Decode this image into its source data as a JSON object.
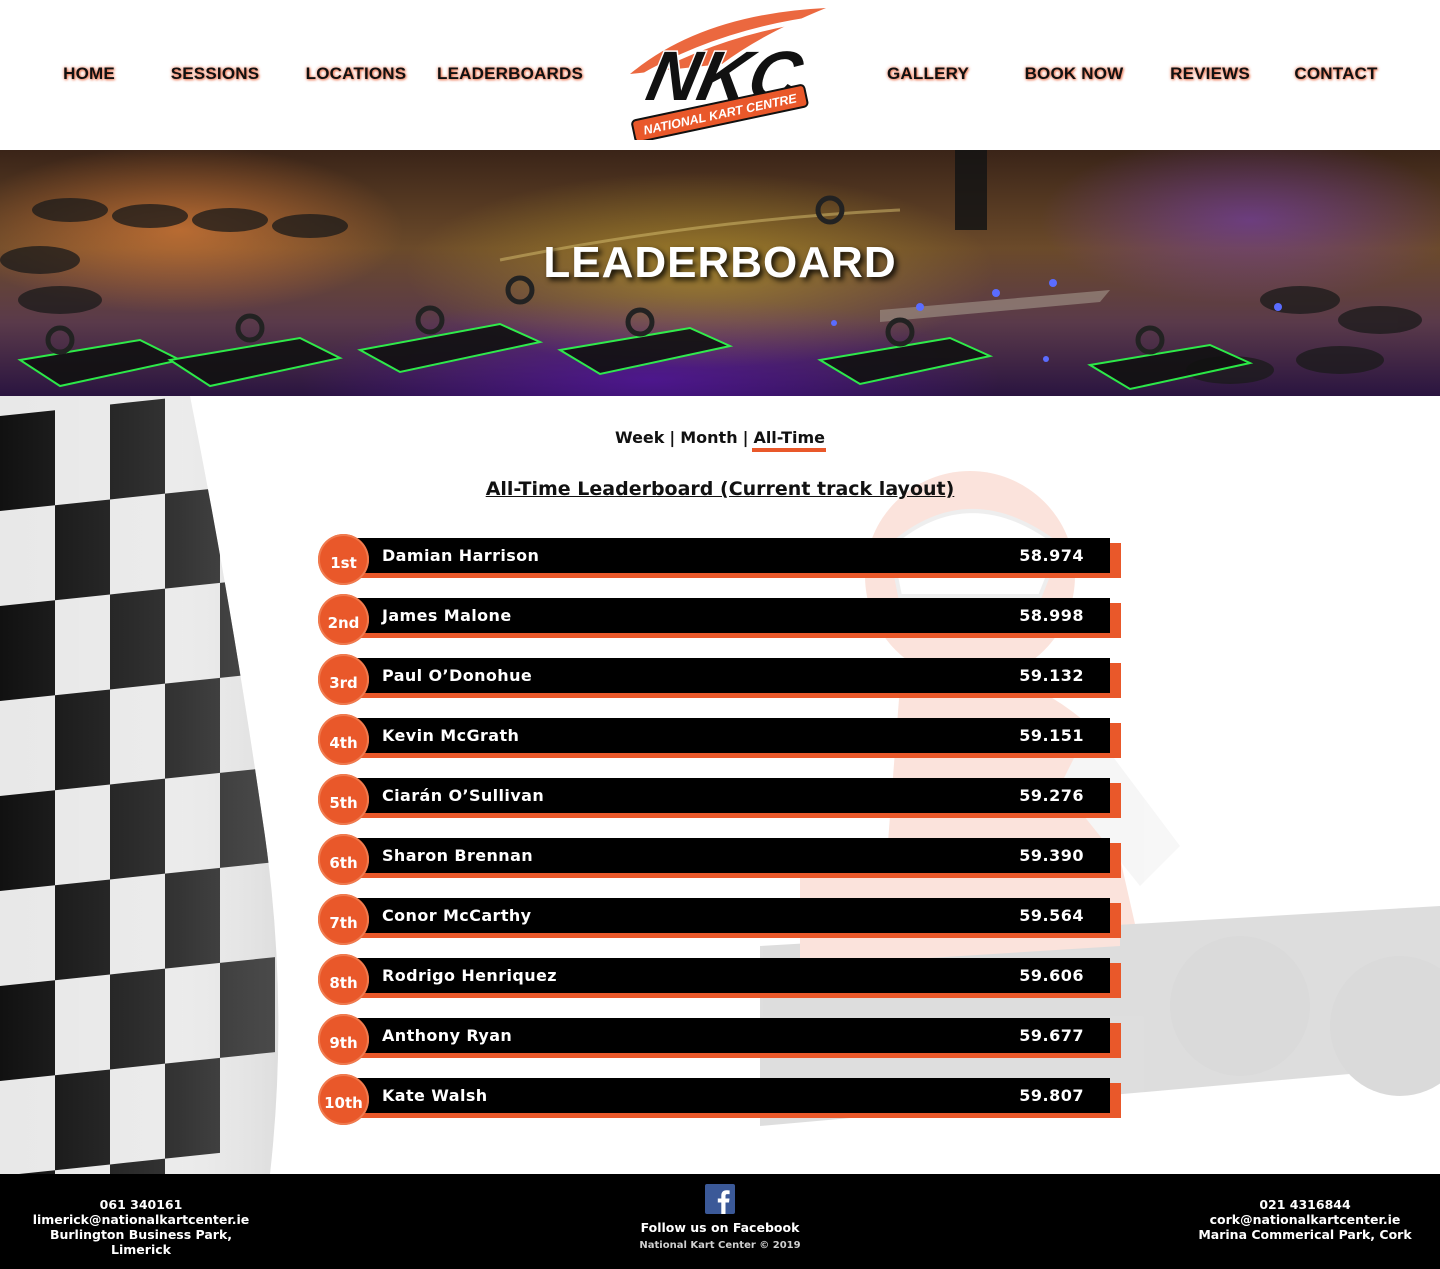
{
  "nav": {
    "home": "HOME",
    "sessions": "SESSIONS",
    "locations": "LOCATIONS",
    "leaderboards": "LEADERBOARDS",
    "gallery": "GALLERY",
    "book_now": "BOOK NOW",
    "reviews": "REVIEWS",
    "contact": "CONTACT"
  },
  "logo": {
    "letters": "NKC",
    "tagline": "NATIONAL KART CENTRE"
  },
  "hero": {
    "title": "LEADERBOARD"
  },
  "period_tabs": {
    "week": "Week",
    "month": "Month",
    "all_time": "All-Time",
    "separator": "|",
    "active": "All-Time"
  },
  "leaderboard": {
    "title": "All-Time Leaderboard (Current track layout)",
    "entries": [
      {
        "position": "1st",
        "name": "Damian Harrison",
        "time": "58.974"
      },
      {
        "position": "2nd",
        "name": "James Malone",
        "time": "58.998"
      },
      {
        "position": "3rd",
        "name": "Paul O’Donohue",
        "time": "59.132"
      },
      {
        "position": "4th",
        "name": "Kevin McGrath",
        "time": "59.151"
      },
      {
        "position": "5th",
        "name": "Ciarán O’Sullivan",
        "time": "59.276"
      },
      {
        "position": "6th",
        "name": "Sharon Brennan",
        "time": "59.390"
      },
      {
        "position": "7th",
        "name": "Conor McCarthy",
        "time": "59.564"
      },
      {
        "position": "8th",
        "name": "Rodrigo Henriquez",
        "time": "59.606"
      },
      {
        "position": "9th",
        "name": "Anthony Ryan",
        "time": "59.677"
      },
      {
        "position": "10th",
        "name": "Kate Walsh",
        "time": "59.807"
      }
    ]
  },
  "footer": {
    "limerick": {
      "phone": "061 340161",
      "email": "limerick@nationalkartcenter.ie",
      "address": "Burlington Business Park, Limerick"
    },
    "cork": {
      "phone": "021 4316844",
      "email": "cork@nationalkartcenter.ie",
      "address": "Marina Commerical Park, Cork"
    },
    "social": {
      "label": "Follow us on Facebook",
      "icon": "facebook-icon"
    },
    "copyright": "National Kart Center © 2019"
  },
  "colors": {
    "accent": "#e9582a",
    "bar": "#000000",
    "footer": "#000000"
  }
}
